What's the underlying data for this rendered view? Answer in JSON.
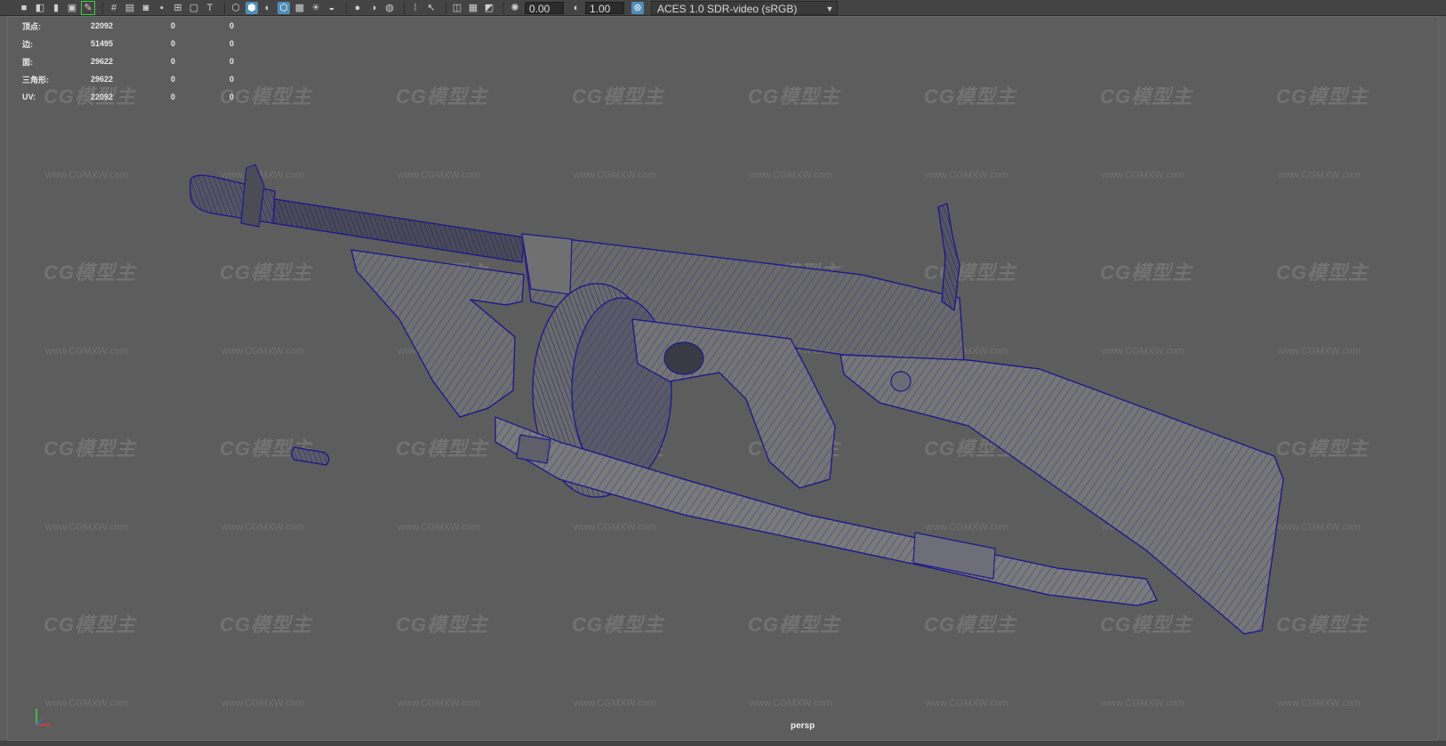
{
  "toolbar": {
    "left_icons": [
      "camera-icon",
      "camera-attr-icon",
      "bookmark-icon",
      "image-plane-icon",
      "grease-pencil-icon",
      "grid-icon",
      "film-gate-icon",
      "resolution-gate-icon",
      "gate-mask-icon",
      "field-chart-icon",
      "safe-action-icon",
      "safe-title-icon",
      "wireframe-icon",
      "smooth-shade-icon",
      "shade-default-icon",
      "wireframe-on-shaded-icon",
      "xray-icon",
      "use-lights-icon",
      "shadows-icon",
      "ssao-icon",
      "motion-blur-icon",
      "aa-icon",
      "isolate-icon",
      "xray-joints-icon",
      "xray-components-icon",
      "pan-zoom-icon",
      "grid-toggle-icon"
    ],
    "exposure_value": "0.00",
    "gamma_value": "1.00",
    "color_space": "ACES 1.0 SDR-video (sRGB)"
  },
  "hud": {
    "rows": [
      {
        "label": "顶点:",
        "v1": "22092",
        "v2": "0",
        "v3": "0"
      },
      {
        "label": "边:",
        "v1": "51495",
        "v2": "0",
        "v3": "0"
      },
      {
        "label": "面:",
        "v1": "29622",
        "v2": "0",
        "v3": "0"
      },
      {
        "label": "三角形:",
        "v1": "29622",
        "v2": "0",
        "v3": "0"
      },
      {
        "label": "UV:",
        "v1": "22092",
        "v2": "0",
        "v3": "0"
      }
    ]
  },
  "watermark": {
    "logo_text": "CG模型主",
    "url_text": "www.CGMXW.com"
  },
  "viewport": {
    "camera_label": "persp",
    "background_color": "#5d5d5d",
    "wire_color": "#1f1a8a"
  }
}
